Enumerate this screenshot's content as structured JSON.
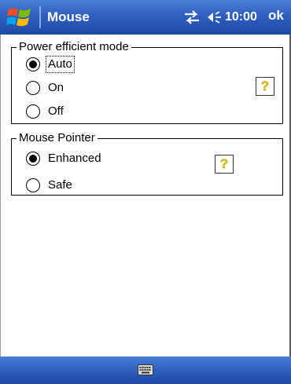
{
  "titlebar": {
    "title": "Mouse",
    "time": "10:00",
    "ok_label": "ok",
    "start_icon": "windows-flag-icon",
    "connectivity_icon": "connectivity-icon",
    "volume_icon": "volume-icon"
  },
  "power_mode": {
    "title": "Power efficient mode",
    "options": [
      {
        "label": "Auto",
        "selected": true
      },
      {
        "label": "On",
        "selected": false
      },
      {
        "label": "Off",
        "selected": false
      }
    ],
    "help_label": "?"
  },
  "mouse_pointer": {
    "title": "Mouse Pointer",
    "options": [
      {
        "label": "Enhanced",
        "selected": true
      },
      {
        "label": "Safe",
        "selected": false
      }
    ],
    "help_label": "?"
  },
  "menubar": {
    "keyboard_icon": "keyboard-icon"
  },
  "colors": {
    "bar_blue": "#2f5fbf",
    "help_yellow": "#e0c800"
  }
}
